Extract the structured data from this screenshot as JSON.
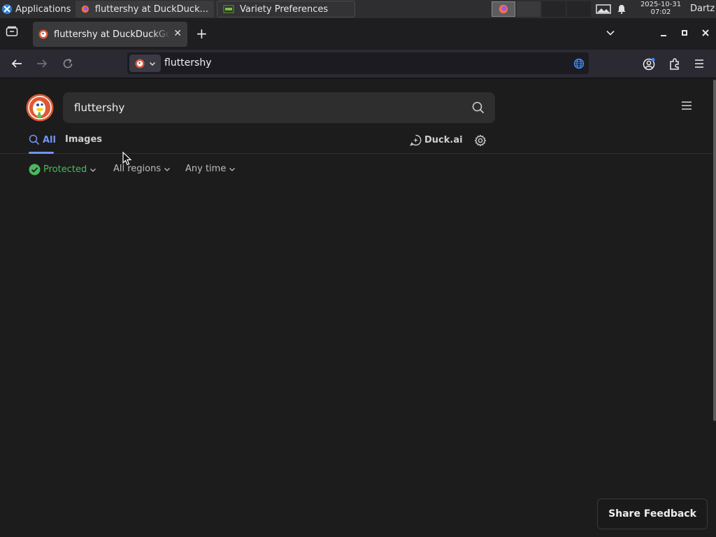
{
  "taskbar": {
    "apps_label": "Applications",
    "task_firefox": "fluttershy at DuckDuck...",
    "task_variety": "Variety Preferences",
    "clock_date": "2025-10-31",
    "clock_time": "07:02",
    "user": "Dartz"
  },
  "browser": {
    "tab_title": "fluttershy at DuckDuckGo",
    "url": "fluttershy"
  },
  "search": {
    "query": "fluttershy",
    "tabs": [
      {
        "label": "All"
      },
      {
        "label": "Images"
      }
    ],
    "duck_ai_label": "Duck.ai",
    "filters": {
      "protected": "Protected",
      "region": "All regions",
      "time": "Any time"
    }
  },
  "feedback_label": "Share Feedback",
  "colors": {
    "accent": "#7295f6",
    "protected_green": "#4cb860",
    "page_bg": "#1c1c1c"
  }
}
